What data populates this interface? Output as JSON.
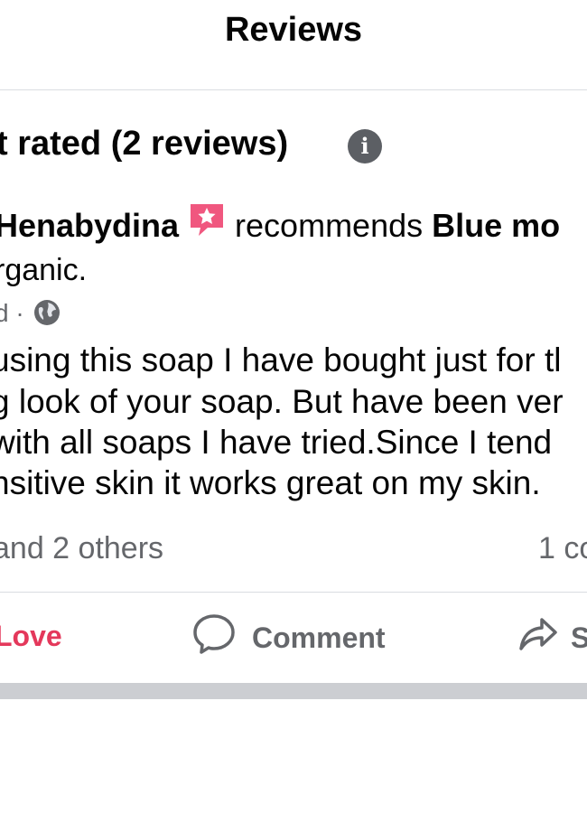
{
  "header": {
    "title": "Reviews"
  },
  "rating": {
    "heading": "t rated (2 reviews)"
  },
  "review": {
    "author": "Henabydina",
    "action": "recommends",
    "product": "Blue mo",
    "product_line2": "rganic.",
    "time": "d ·",
    "lines": [
      "using this soap I have bought just for tl",
      "g look of your soap. But have been ver",
      "with all soaps I have tried.Since I tend",
      "nsitive skin it  works great on my skin."
    ],
    "reactions": "and 2 others",
    "comment_count": "1 co"
  },
  "actions": {
    "love_label": "Love",
    "comment_label": "Comment",
    "share_label": "S"
  },
  "colors": {
    "love": "#e4385b",
    "secondary_text": "#65676b",
    "badge": "#f0577f",
    "divider": "#dadde1"
  },
  "icons": [
    "info-icon",
    "recommend-badge-icon",
    "globe-icon",
    "comment-icon",
    "share-icon"
  ]
}
